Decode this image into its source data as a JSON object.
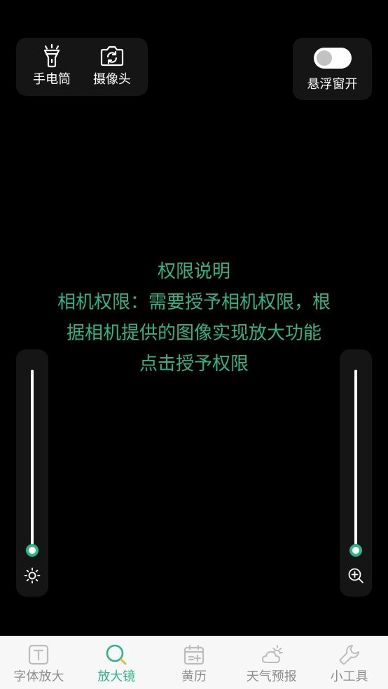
{
  "colors": {
    "accent": "#2bb68a",
    "background": "#000000",
    "card": "#151515",
    "tab_inactive": "#8c8c8c"
  },
  "tools": {
    "flashlight_label": "手电筒",
    "camera_label": "摄像头"
  },
  "float_window": {
    "label": "悬浮窗开",
    "enabled": false
  },
  "permission": {
    "title": "权限说明",
    "line1": "相机权限：需要授予相机权限，根",
    "line2": "据相机提供的图像实现放大功能",
    "grant_link": "点击授予权限"
  },
  "sliders": {
    "brightness": {
      "icon": "sun-icon",
      "level": 0
    },
    "zoom": {
      "icon": "zoom-in-icon",
      "level": 0
    }
  },
  "tabbar": {
    "items": [
      {
        "label": "字体放大",
        "icon": "text-size-icon",
        "active": false
      },
      {
        "label": "放大镜",
        "icon": "magnifier-icon",
        "active": true
      },
      {
        "label": "黄历",
        "icon": "calendar-icon",
        "active": false
      },
      {
        "label": "天气预报",
        "icon": "weather-icon",
        "active": false
      },
      {
        "label": "小工具",
        "icon": "wrench-icon",
        "active": false
      }
    ]
  }
}
